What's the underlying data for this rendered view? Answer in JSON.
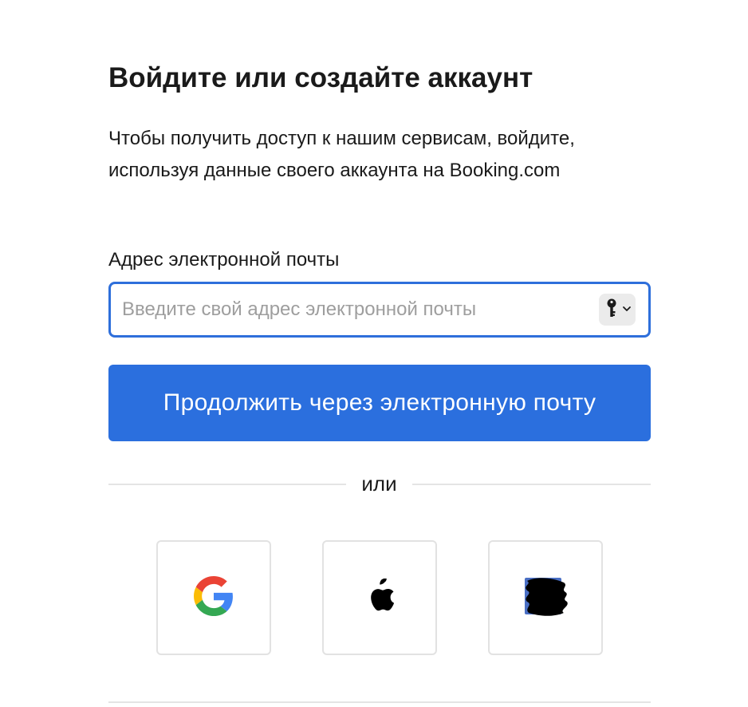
{
  "title": "Войдите или создайте аккаунт",
  "subtitle": "Чтобы получить доступ к нашим сервисам, войдите, используя данные своего аккаунта на Booking.com",
  "email": {
    "label": "Адрес электронной почты",
    "placeholder": "Введите свой адрес электронной почты",
    "value": "",
    "autofill_icon": "key-icon"
  },
  "continue_button": {
    "label": "Продолжить через электронную почту",
    "color": "#2b6fde"
  },
  "divider": {
    "label": "или"
  },
  "social_buttons": [
    {
      "provider": "google",
      "icon": "google-logo-icon"
    },
    {
      "provider": "apple",
      "icon": "apple-logo-icon"
    },
    {
      "provider": "facebook",
      "icon": "facebook-logo-icon"
    }
  ],
  "colors": {
    "accent": "#2b6fde",
    "focus_border": "#2e6fdb",
    "text": "#1a1a1a",
    "placeholder": "#9e9e9e",
    "divider": "#e4e4e4"
  }
}
